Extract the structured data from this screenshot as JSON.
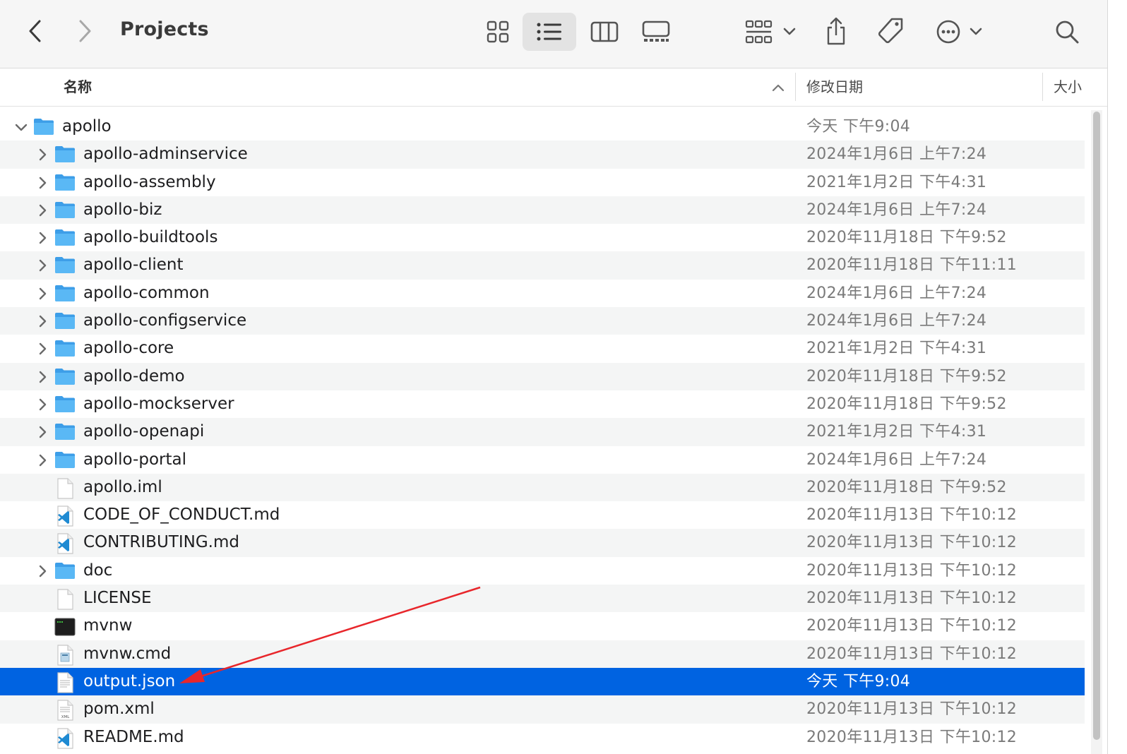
{
  "window": {
    "title": "Projects"
  },
  "colors": {
    "selection": "#0063e1",
    "annotation_arrow": "#e8262b",
    "folder": "#4fb0f0"
  },
  "columns": {
    "name": "名称",
    "date": "修改日期",
    "size": "大小"
  },
  "rows": [
    {
      "name": "apollo",
      "date": "今天 下午9:04",
      "type": "folder",
      "level": 0,
      "disclosure": "expanded"
    },
    {
      "name": "apollo-adminservice",
      "date": "2024年1月6日 上午7:24",
      "type": "folder",
      "level": 1,
      "disclosure": "collapsed"
    },
    {
      "name": "apollo-assembly",
      "date": "2021年1月2日 下午4:31",
      "type": "folder",
      "level": 1,
      "disclosure": "collapsed"
    },
    {
      "name": "apollo-biz",
      "date": "2024年1月6日 上午7:24",
      "type": "folder",
      "level": 1,
      "disclosure": "collapsed"
    },
    {
      "name": "apollo-buildtools",
      "date": "2020年11月18日 下午9:52",
      "type": "folder",
      "level": 1,
      "disclosure": "collapsed"
    },
    {
      "name": "apollo-client",
      "date": "2020年11月18日 下午11:11",
      "type": "folder",
      "level": 1,
      "disclosure": "collapsed"
    },
    {
      "name": "apollo-common",
      "date": "2024年1月6日 上午7:24",
      "type": "folder",
      "level": 1,
      "disclosure": "collapsed"
    },
    {
      "name": "apollo-configservice",
      "date": "2024年1月6日 上午7:24",
      "type": "folder",
      "level": 1,
      "disclosure": "collapsed"
    },
    {
      "name": "apollo-core",
      "date": "2021年1月2日 下午4:31",
      "type": "folder",
      "level": 1,
      "disclosure": "collapsed"
    },
    {
      "name": "apollo-demo",
      "date": "2020年11月18日 下午9:52",
      "type": "folder",
      "level": 1,
      "disclosure": "collapsed"
    },
    {
      "name": "apollo-mockserver",
      "date": "2020年11月18日 下午9:52",
      "type": "folder",
      "level": 1,
      "disclosure": "collapsed"
    },
    {
      "name": "apollo-openapi",
      "date": "2021年1月2日 下午4:31",
      "type": "folder",
      "level": 1,
      "disclosure": "collapsed"
    },
    {
      "name": "apollo-portal",
      "date": "2024年1月6日 上午7:24",
      "type": "folder",
      "level": 1,
      "disclosure": "collapsed"
    },
    {
      "name": "apollo.iml",
      "date": "2020年11月18日 下午9:52",
      "type": "doc-blank",
      "level": 1,
      "disclosure": "none"
    },
    {
      "name": "CODE_OF_CONDUCT.md",
      "date": "2020年11月13日 下午10:12",
      "type": "vscode",
      "level": 1,
      "disclosure": "none"
    },
    {
      "name": "CONTRIBUTING.md",
      "date": "2020年11月13日 下午10:12",
      "type": "vscode",
      "level": 1,
      "disclosure": "none"
    },
    {
      "name": "doc",
      "date": "2020年11月13日 下午10:12",
      "type": "folder",
      "level": 1,
      "disclosure": "collapsed"
    },
    {
      "name": "LICENSE",
      "date": "2020年11月13日 下午10:12",
      "type": "doc-blank",
      "level": 1,
      "disclosure": "none"
    },
    {
      "name": "mvnw",
      "date": "2020年11月13日 下午10:12",
      "type": "terminal",
      "level": 1,
      "disclosure": "none"
    },
    {
      "name": "mvnw.cmd",
      "date": "2020年11月13日 下午10:12",
      "type": "cmd",
      "level": 1,
      "disclosure": "none"
    },
    {
      "name": "output.json",
      "date": "今天 下午9:04",
      "type": "doc-text",
      "level": 1,
      "disclosure": "none",
      "selected": true
    },
    {
      "name": "pom.xml",
      "date": "2020年11月13日 下午10:12",
      "type": "xml",
      "level": 1,
      "disclosure": "none"
    },
    {
      "name": "README.md",
      "date": "2020年11月13日 下午10:12",
      "type": "vscode",
      "level": 1,
      "disclosure": "none"
    }
  ]
}
